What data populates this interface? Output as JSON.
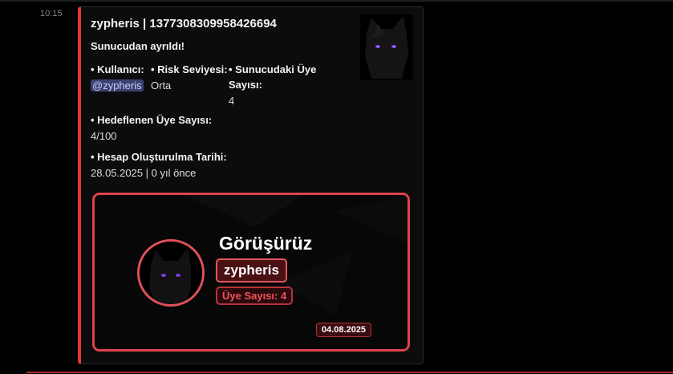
{
  "message": {
    "timestamp": "10:15"
  },
  "embed": {
    "title": "zypheris | 1377308309958426694",
    "description": "Sunucudan ayrıldı!",
    "accent_color": "#e53935",
    "fields": [
      {
        "name": "• Kullanıcı:",
        "value": "@zypheris"
      },
      {
        "name": "• Risk Seviyesi:",
        "value": "Orta"
      },
      {
        "name": "• Sunucudaki Üye Sayısı:",
        "value": "4"
      },
      {
        "name": "• Hedeflenen Üye Sayısı:",
        "value": "4/100"
      },
      {
        "name": "• Hesap Oluşturulma Tarihi:",
        "value": "28.05.2025 | 0 yıl önce"
      }
    ],
    "thumbnail_icon": "cat-avatar-icon"
  },
  "card": {
    "heading": "Görüşürüz",
    "username": "zypheris",
    "member_count": "Üye Sayısı: 4",
    "date": "04.08.2025",
    "border_color": "#e0424a",
    "avatar_icon": "cat-avatar-icon"
  }
}
